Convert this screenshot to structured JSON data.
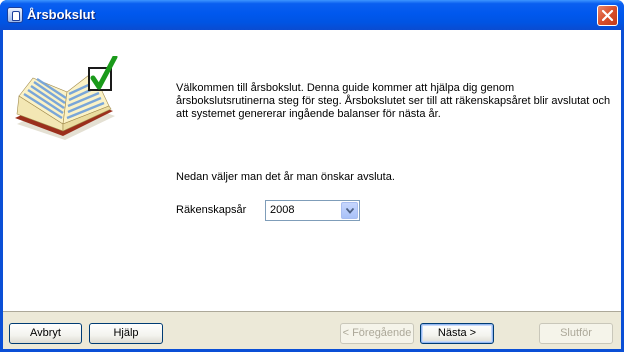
{
  "window": {
    "title": "Årsbokslut"
  },
  "content": {
    "intro_lines": [
      "Välkommen till årsbokslut. Denna guide kommer att hjälpa dig genom",
      "årsbokslutsrutinerna steg för steg. Årsbokslutet ser till att räkenskapsåret blir avslutat och",
      "att systemet genererar ingående balanser för nästa år."
    ],
    "instruction": "Nedan väljer man det år man önskar avsluta.",
    "year_label": "Räkenskapsår",
    "year_value": "2008"
  },
  "buttons": {
    "cancel": "Avbryt",
    "help": "Hjälp",
    "previous": "< Föregående",
    "next": "Nästa >",
    "finish": "Slutför"
  },
  "icons": {
    "app": "app-icon",
    "close": "close-icon",
    "illustration": "book-checkmark-icon",
    "dropdown": "chevron-down-icon"
  },
  "colors": {
    "titlebar": "#0054e3",
    "close": "#d94f2b",
    "footer": "#ece9d8",
    "checkmark": "#1a9a1a"
  }
}
